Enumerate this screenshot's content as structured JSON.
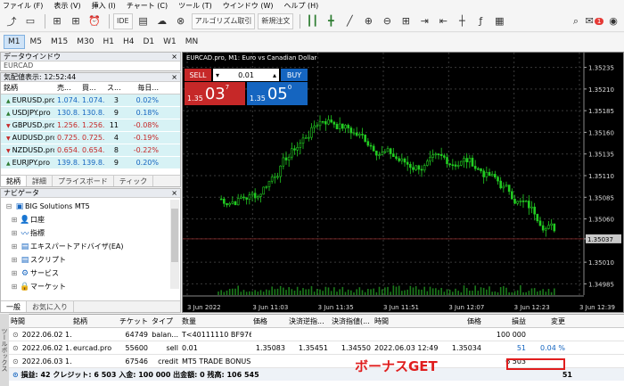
{
  "menu": [
    "ファイル (F)",
    "表示 (V)",
    "挿入 (I)",
    "チャート (C)",
    "ツール (T)",
    "ウインドウ (W)",
    "ヘルプ (H)"
  ],
  "toolbar": {
    "ide": "IDE",
    "algo": "アルゴリズム取引",
    "new_order": "新規注文",
    "notif_count": "1"
  },
  "timeframes": [
    "M1",
    "M5",
    "M15",
    "M30",
    "H1",
    "H4",
    "D1",
    "W1",
    "MN"
  ],
  "data_window": {
    "title": "データウインドウ",
    "sub": "EURCAD"
  },
  "market_watch": {
    "title": "気配値表示: 12:52:44",
    "headers": [
      "銘柄",
      "売...",
      "買...",
      "ス...",
      "毎日..."
    ],
    "rows": [
      {
        "sym": "EURUSD.pro",
        "bid": "1.074...",
        "ask": "1.074...",
        "sp": "3",
        "chg": "0.02%",
        "dir": "up"
      },
      {
        "sym": "USDJPY.pro",
        "bid": "130.8...",
        "ask": "130.8...",
        "sp": "9",
        "chg": "0.18%",
        "dir": "up"
      },
      {
        "sym": "GBPUSD.pro",
        "bid": "1.256...",
        "ask": "1.256...",
        "sp": "11",
        "chg": "-0.08%",
        "dir": "dn"
      },
      {
        "sym": "AUDUSD.pro",
        "bid": "0.725...",
        "ask": "0.725...",
        "sp": "4",
        "chg": "-0.19%",
        "dir": "dn"
      },
      {
        "sym": "NZDUSD.pro",
        "bid": "0.654...",
        "ask": "0.654...",
        "sp": "8",
        "chg": "-0.22%",
        "dir": "dn"
      },
      {
        "sym": "EURJPY.pro",
        "bid": "139.8...",
        "ask": "139.8...",
        "sp": "9",
        "chg": "0.20%",
        "dir": "up"
      }
    ],
    "tabs": [
      "銘柄",
      "詳細",
      "プライスボード",
      "ティック"
    ]
  },
  "navigator": {
    "title": "ナビゲータ",
    "items": [
      {
        "label": "BIG Solutions MT5",
        "icon": "▣",
        "indent": 0
      },
      {
        "label": "口座",
        "icon": "👤",
        "indent": 1
      },
      {
        "label": "指標",
        "icon": "〰",
        "indent": 1
      },
      {
        "label": "エキスパートアドバイザ(EA)",
        "icon": "▤",
        "indent": 1
      },
      {
        "label": "スクリプト",
        "icon": "▤",
        "indent": 1
      },
      {
        "label": "サービス",
        "icon": "⚙",
        "indent": 1
      },
      {
        "label": "マーケット",
        "icon": "🔒",
        "indent": 1
      }
    ],
    "tabs": [
      "一般",
      "お気に入り"
    ]
  },
  "chart": {
    "title": "EURCAD.pro, M1: Euro vs Canadian Dollar",
    "sell_label": "SELL",
    "buy_label": "BUY",
    "lot": "0.01",
    "sell_big": "03",
    "sell_small": "1.35",
    "sell_sup": "7",
    "buy_big": "05",
    "buy_small": "1.35",
    "buy_sup": "0",
    "prices": [
      "1.35235",
      "1.35210",
      "1.35185",
      "1.35160",
      "1.35135",
      "1.35110",
      "1.35085",
      "1.35060",
      "1.35037",
      "1.35010",
      "1.34985"
    ],
    "current_price": "1.35037",
    "times": [
      "3 Jun 2022",
      "3 Jun 11:03",
      "3 Jun 11:35",
      "3 Jun 11:51",
      "3 Jun 12:07",
      "3 Jun 12:23",
      "3 Jun 12:39"
    ],
    "grid_color": "#3a3a3a",
    "candle_color": "#22cc22"
  },
  "toolbox": {
    "headers": [
      "時間",
      "銘柄",
      "チケット",
      "タイプ",
      "数量",
      "価格",
      "決済逆指...",
      "決済指値(...",
      "時間",
      "価格",
      "損益",
      "変更"
    ],
    "rows": [
      [
        "2022.06.02 1...",
        "",
        "64749",
        "balan...",
        "T<40111110 BF976091",
        "",
        "",
        "",
        "",
        "",
        "100 000",
        ""
      ],
      [
        "2022.06.02 1...",
        "eurcad.pro",
        "55600",
        "sell",
        "0.01",
        "1.35083",
        "1.35451",
        "1.34550",
        "2022.06.03 12:49:30",
        "1.35034",
        "51",
        "0.04 %"
      ],
      [
        "2022.06.03 1...",
        "",
        "67546",
        "credit",
        "MT5 TRADE BONUS 426",
        "",
        "",
        "",
        "",
        "",
        "6 503",
        ""
      ]
    ],
    "summary": "損益: 42 クレジット: 6 503 入金: 100 000 出金額: 0 残高: 106 545",
    "summary_value": "51",
    "side_label": "ツールボックス"
  },
  "bonus_text": "ボーナスGET"
}
